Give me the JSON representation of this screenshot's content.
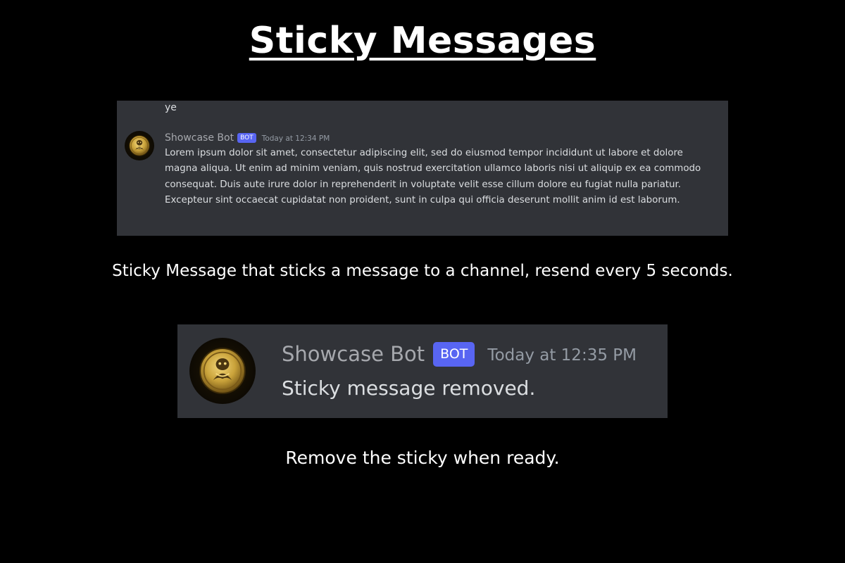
{
  "page": {
    "title": "Sticky Messages"
  },
  "sticky_example": {
    "previous_message_text": "ye",
    "author": "Showcase Bot",
    "bot_tag": "BOT",
    "timestamp": "Today at 12:34 PM",
    "message": "Lorem ipsum dolor sit amet, consectetur adipiscing elit, sed do eiusmod tempor incididunt ut labore et dolore magna aliqua. Ut enim ad minim veniam, quis nostrud exercitation ullamco laboris nisi ut aliquip ex ea commodo consequat. Duis aute irure dolor in reprehenderit in voluptate velit esse cillum dolore eu fugiat nulla pariatur. Excepteur sint occaecat cupidatat non proident, sunt in culpa qui officia deserunt mollit anim id est laborum."
  },
  "caption_1": "Sticky Message that sticks a message to a channel, resend every 5 seconds.",
  "remove_example": {
    "author": "Showcase Bot",
    "bot_tag": "BOT",
    "timestamp": "Today at 12:35 PM",
    "message": "Sticky message removed."
  },
  "caption_2": "Remove the sticky when ready.",
  "colors": {
    "page_background": "#000000",
    "chat_background": "#313338",
    "author_name": "#a6a8ad",
    "bot_tag_background": "#5865f2",
    "timestamp": "#949ba4",
    "message_text": "#dbdee1",
    "avatar_gold": "#c9a23a"
  },
  "icons": {
    "avatar": "gold-coin-creature-avatar-icon"
  }
}
